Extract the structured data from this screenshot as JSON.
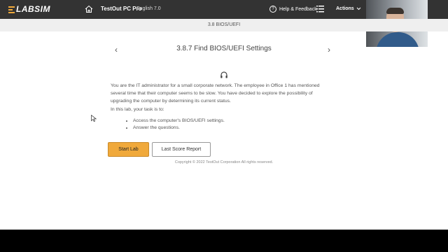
{
  "header": {
    "logo_text": "LABSIM",
    "product": "TestOut PC Pro",
    "language": "English 7.0",
    "help": "Help & Feedback",
    "actions": "Actions",
    "icons": [
      "home-icon",
      "help-icon",
      "list-icon",
      "chevron-down-icon"
    ],
    "accent_color": "#f0a93b"
  },
  "breadcrumb": "3.8 BIOS/UEFI",
  "title": "3.8.7 Find BIOS/UEFI Settings",
  "intro": "You are the IT administrator for a small corporate network. The employee in Office 1 has mentioned several time that their computer seems to be slow. You have decided to explore the possibility of upgrading the computer by determining its current status.",
  "task_intro": "In this lab, your task is to:",
  "tasks": [
    "Access the computer's BIOS/UEFI settings.",
    "Answer the questions."
  ],
  "buttons": {
    "start": "Start Lab",
    "last_score": "Last Score Report"
  },
  "footer": "Copyright © 2022 TestOut Corporation  All rights reserved."
}
